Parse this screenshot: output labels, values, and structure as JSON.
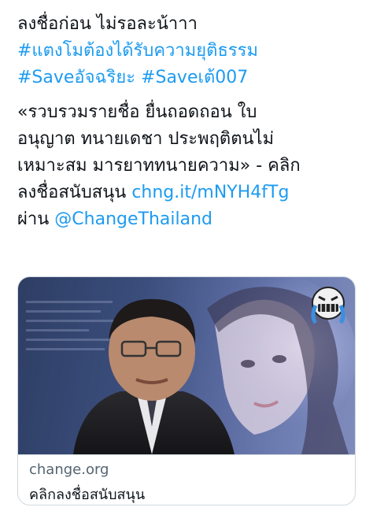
{
  "tweet": {
    "line1": "ลงชื่อก่อน ไม่รอละน้าาา",
    "hashtag1": "#แตงโมต้องได้รับความยุติธรรม",
    "hashtag2": "#Saveอัจฉริยะ",
    "hashtag3": "#Saveเต้007",
    "body_line1": "«รวบรวมรายชื่อ ยื่นถอดถอน ใบ",
    "body_line2": "อนุญาต ทนายเดชา ประพฤติตนไม่",
    "body_line3": "เหมาะสม มารยาททนายความ» - คลิก",
    "body_line4_prefix": "ลงชื่อสนับสนุน",
    "link": "chng.it/mNYH4fTg",
    "via_prefix": "ผ่าน",
    "mention": "@ChangeThailand"
  },
  "card": {
    "domain": "change.org",
    "title": "คลิกลงชื่อสนับสนุน"
  },
  "colors": {
    "link": "#1d9bf0",
    "text": "#0f1419",
    "muted": "#536471",
    "border": "#cfd9de"
  }
}
